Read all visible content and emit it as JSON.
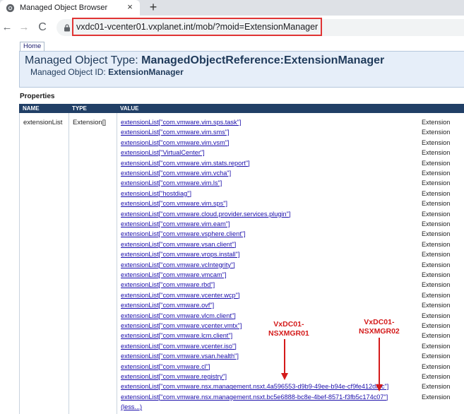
{
  "browser": {
    "tab_title": "Managed Object Browser",
    "tab_close": "×",
    "new_tab": "+",
    "back": "←",
    "forward": "→",
    "reload": "C",
    "url": "vxdc01-vcenter01.vxplanet.int/mob/?moid=ExtensionManager"
  },
  "page": {
    "home_label": "Home",
    "type_label": "Managed Object Type:",
    "type_value": "ManagedObjectReference:ExtensionManager",
    "id_label": "Managed Object ID:",
    "id_value": "ExtensionManager",
    "properties_label": "Properties"
  },
  "table": {
    "headers": [
      "NAME",
      "TYPE",
      "VALUE"
    ],
    "name": "extensionList",
    "type": "Extension[]",
    "rows": [
      {
        "link": "extensionList[\"com.vmware.vim.sps.task\"]",
        "type": "Extension"
      },
      {
        "link": "extensionList[\"com.vmware.vim.sms\"]",
        "type": "Extension"
      },
      {
        "link": "extensionList[\"com.vmware.vim.vsm\"]",
        "type": "Extension"
      },
      {
        "link": "extensionList[\"VirtualCenter\"]",
        "type": "Extension"
      },
      {
        "link": "extensionList[\"com.vmware.vim.stats.report\"]",
        "type": "Extension"
      },
      {
        "link": "extensionList[\"com.vmware.vim.vcha\"]",
        "type": "Extension"
      },
      {
        "link": "extensionList[\"com.vmware.vim.ls\"]",
        "type": "Extension"
      },
      {
        "link": "extensionList[\"hostdiag\"]",
        "type": "Extension"
      },
      {
        "link": "extensionList[\"com.vmware.vim.sps\"]",
        "type": "Extension"
      },
      {
        "link": "extensionList[\"com.vmware.cloud.provider.services.plugin\"]",
        "type": "Extension"
      },
      {
        "link": "extensionList[\"com.vmware.vim.eam\"]",
        "type": "Extension"
      },
      {
        "link": "extensionList[\"com.vmware.vsphere.client\"]",
        "type": "Extension"
      },
      {
        "link": "extensionList[\"com.vmware.vsan.client\"]",
        "type": "Extension"
      },
      {
        "link": "extensionList[\"com.vmware.vrops.install\"]",
        "type": "Extension"
      },
      {
        "link": "extensionList[\"com.vmware.vcIntegrity\"]",
        "type": "Extension"
      },
      {
        "link": "extensionList[\"com.vmware.vmcam\"]",
        "type": "Extension"
      },
      {
        "link": "extensionList[\"com.vmware.rbd\"]",
        "type": "Extension"
      },
      {
        "link": "extensionList[\"com.vmware.vcenter.wcp\"]",
        "type": "Extension"
      },
      {
        "link": "extensionList[\"com.vmware.ovf\"]",
        "type": "Extension"
      },
      {
        "link": "extensionList[\"com.vmware.vlcm.client\"]",
        "type": "Extension"
      },
      {
        "link": "extensionList[\"com.vmware.vcenter.vmtx\"]",
        "type": "Extension"
      },
      {
        "link": "extensionList[\"com.vmware.lcm.client\"]",
        "type": "Extension"
      },
      {
        "link": "extensionList[\"com.vmware.vcenter.iso\"]",
        "type": "Extension"
      },
      {
        "link": "extensionList[\"com.vmware.vsan.health\"]",
        "type": "Extension"
      },
      {
        "link": "extensionList[\"com.vmware.cl\"]",
        "type": "Extension"
      },
      {
        "link": "extensionList[\"com.vmware.registry\"]",
        "type": "Extension"
      },
      {
        "link": "extensionList[\"com.vmware.nsx.management.nsxt.4a596553-d9b9-49ee-b94e-cf9fe412df9c\"]",
        "type": "Extension"
      },
      {
        "link": "extensionList[\"com.vmware.nsx.management.nsxt.bc5e6888-bc8e-4bef-8571-f3fb5c174c07\"]",
        "type": "Extension"
      }
    ],
    "less_label": "(less...)"
  },
  "annotations": {
    "nsxmgr01": {
      "line1": "VxDC01-",
      "line2": "NSXMGR01"
    },
    "nsxmgr02": {
      "line1": "VxDC01-",
      "line2": "NSXMGR02"
    },
    "color": "#d41a1a"
  }
}
